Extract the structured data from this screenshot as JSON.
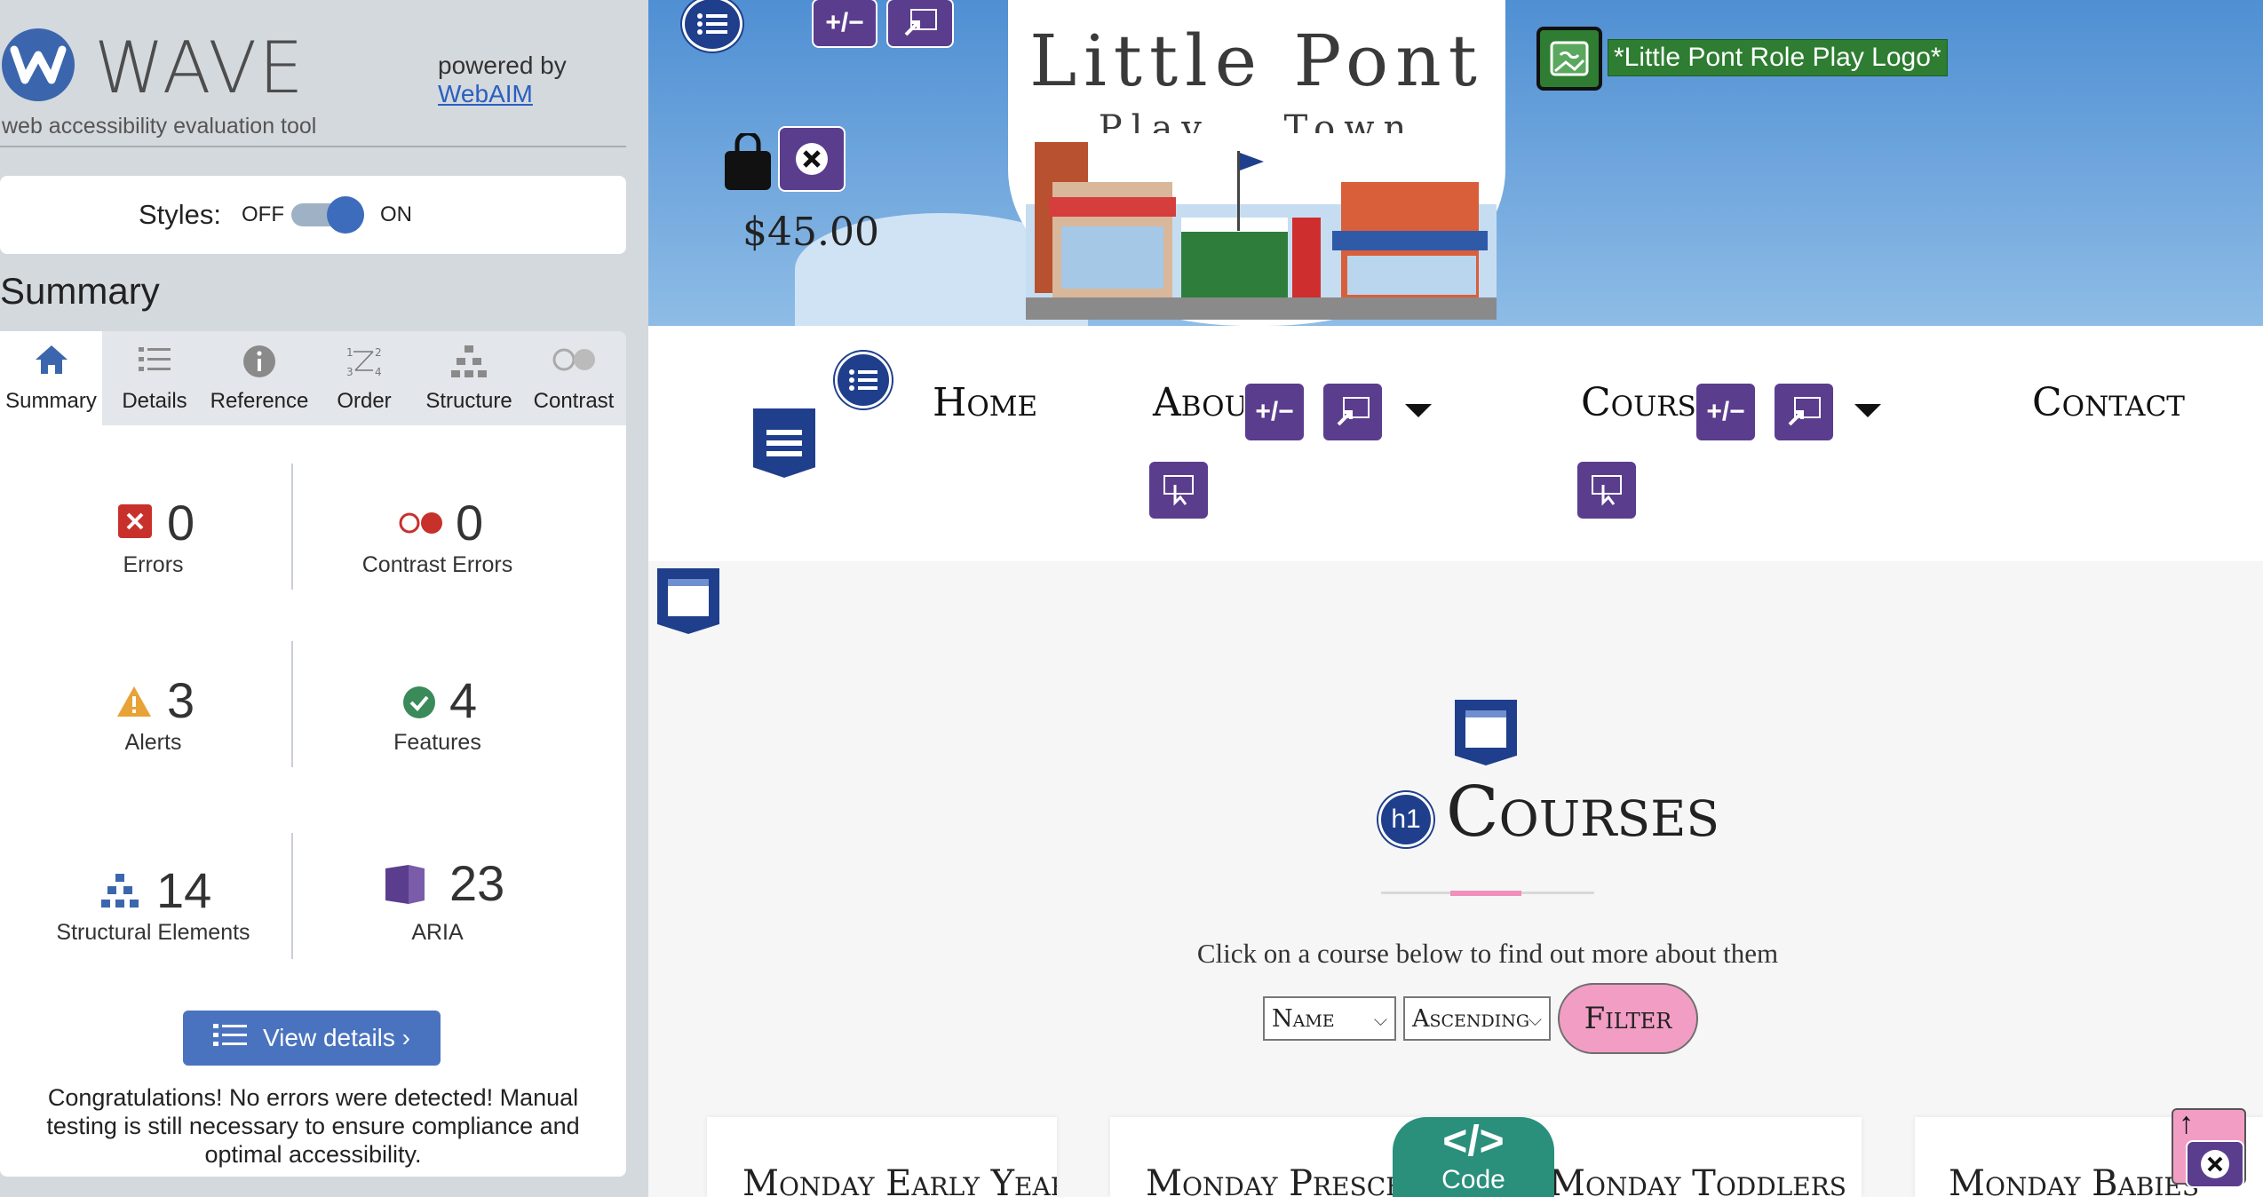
{
  "wave": {
    "logo_letter": "W",
    "wordmark": "WAVE",
    "tagline": "web accessibility evaluation tool",
    "powered_by": "powered by",
    "webaim_link": "WebAIM",
    "styles_label": "Styles:",
    "toggle_off": "OFF",
    "toggle_on": "ON",
    "summary_heading": "Summary",
    "tabs": [
      {
        "label": "Summary",
        "icon": "home-icon",
        "active": true
      },
      {
        "label": "Details",
        "icon": "list-icon"
      },
      {
        "label": "Reference",
        "icon": "info-icon"
      },
      {
        "label": "Order",
        "icon": "order-icon"
      },
      {
        "label": "Structure",
        "icon": "structure-icon"
      },
      {
        "label": "Contrast",
        "icon": "contrast-icon"
      }
    ],
    "stats": {
      "errors": {
        "count": "0",
        "label": "Errors"
      },
      "contrast_errors": {
        "count": "0",
        "label": "Contrast Errors"
      },
      "alerts": {
        "count": "3",
        "label": "Alerts"
      },
      "features": {
        "count": "4",
        "label": "Features"
      },
      "structural": {
        "count": "14",
        "label": "Structural Elements"
      },
      "aria": {
        "count": "23",
        "label": "ARIA"
      }
    },
    "view_details": "View details ›",
    "congrats": "Congratulations! No errors were detected! Manual testing is still necessary to ensure compliance and optimal accessibility."
  },
  "site": {
    "title": "Little Pont",
    "subtitle": "Play Town",
    "cart_total": "$45.00",
    "logo_alt": "*Little Pont Role Play Logo*",
    "nav": {
      "home": "Home",
      "about": "About",
      "courses": "Courses",
      "contact": "Contact"
    },
    "wave_badges": {
      "plus_minus": "+/−",
      "h1": "h1"
    },
    "page_heading": "Courses",
    "intro": "Click on a course below to find out more about them",
    "sort_field": "Name",
    "sort_order": "Ascending",
    "filter_button": "Filter",
    "cards": [
      {
        "title": "Monday Early Years"
      },
      {
        "title": "Monday Preschool"
      },
      {
        "title": "Monday Toddlers"
      },
      {
        "title": "Monday Babies"
      }
    ],
    "code_tag": "</>",
    "code_label": "Code",
    "to_top": "↑"
  },
  "colors": {
    "wave_blue": "#3b66ad",
    "wave_purple": "#5b3d8d",
    "wave_navy": "#1f3f8c",
    "pink": "#f29ec4",
    "code_green": "#2a8f7b",
    "logo_green": "#2e7d32"
  }
}
